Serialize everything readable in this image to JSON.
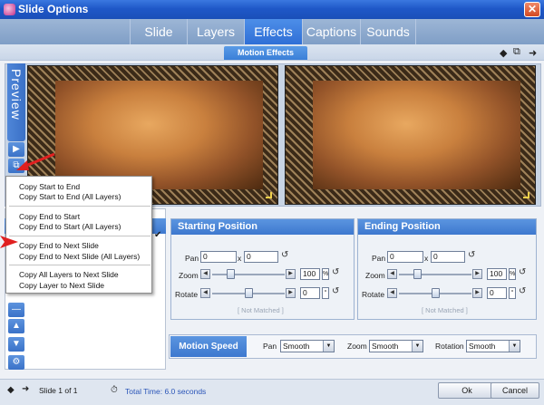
{
  "window": {
    "title": "Slide Options",
    "close_glyph": "✕"
  },
  "tabs": [
    {
      "label": "Slide"
    },
    {
      "label": "Layers"
    },
    {
      "label": "Effects"
    },
    {
      "label": "Captions"
    },
    {
      "label": "Sounds"
    }
  ],
  "active_tab": "Effects",
  "subtab": {
    "label": "Motion Effects"
  },
  "nav": {
    "prev_glyph": "◆",
    "copy_glyph": "⧉",
    "next_glyph": "➜"
  },
  "preview": {
    "label": "Preview"
  },
  "context_menu": {
    "items": [
      {
        "label": "Copy Start to End"
      },
      {
        "label": "Copy Start to End (All Layers)"
      },
      {
        "label": "Copy End to Start"
      },
      {
        "label": "Copy End to Start (All Layers)"
      },
      {
        "label": "Copy End to Next Slide"
      },
      {
        "label": "Copy End to Next Slide (All Layers)"
      },
      {
        "label": "Copy All Layers to Next Slide"
      },
      {
        "label": "Copy Layer to Next Slide"
      }
    ]
  },
  "starting_position": {
    "title": "Starting Position",
    "pan_label": "Pan",
    "pan_x": "0",
    "pan_sep": "x",
    "pan_y": "0",
    "zoom_label": "Zoom",
    "zoom_value": "100",
    "zoom_unit": "%",
    "zoom_level": 0.25,
    "rotate_label": "Rotate",
    "rotate_value": "0",
    "rotate_unit": "°",
    "rotate_level": 0.5,
    "not_matched": "[ Not Matched ]"
  },
  "ending_position": {
    "title": "Ending Position",
    "pan_label": "Pan",
    "pan_x": "0",
    "pan_sep": "x",
    "pan_y": "0",
    "zoom_label": "Zoom",
    "zoom_value": "100",
    "zoom_unit": "%",
    "zoom_level": 0.25,
    "rotate_label": "Rotate",
    "rotate_value": "0",
    "rotate_unit": "°",
    "rotate_level": 0.5,
    "not_matched": "[ Not Matched ]"
  },
  "motion_speed": {
    "title": "Motion Speed",
    "pan_label": "Pan",
    "pan_value": "Smooth",
    "zoom_label": "Zoom",
    "zoom_value": "Smooth",
    "rotation_label": "Rotation",
    "rotation_value": "Smooth"
  },
  "footer": {
    "slide_status": "Slide 1 of 1",
    "total_time": "Total Time: 6.0 seconds",
    "ok_label": "Ok",
    "cancel_label": "Cancel"
  },
  "colors": {
    "accent": "#3d78cf",
    "title_bar": "#1f58c8",
    "arrow": "#e02020"
  }
}
